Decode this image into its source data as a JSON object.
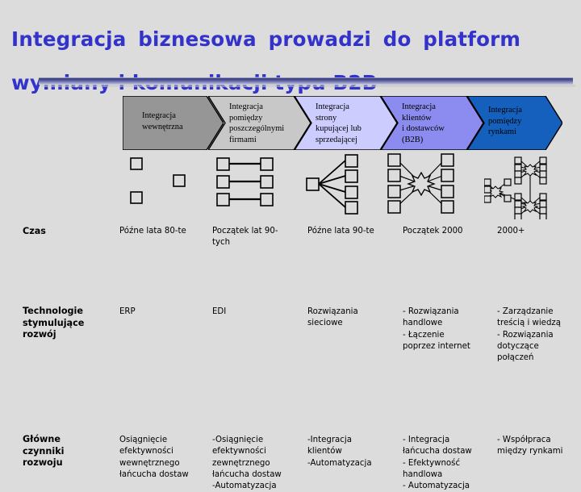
{
  "slide": {
    "background_color": "#dcdcdc",
    "title": {
      "line1": "Integracja   biznesowa   prowadzi   do   platform",
      "line2": "wymiany i komunikacji typu B2B",
      "color": "#3333cc"
    }
  },
  "stages": [
    {
      "id": "stage-1",
      "label": "Integracja\nwewnętrzna",
      "fill": "#969696",
      "stroke": "#000000",
      "notched": false
    },
    {
      "id": "stage-2",
      "label": "Integracja\npomiędzy\nposzczególnymi\nfirmami",
      "fill": "#c8c8c8",
      "stroke": "#000000",
      "notched": true
    },
    {
      "id": "stage-3",
      "label": "Integracja\nstrony\nkupującej lub\nsprzedającej",
      "fill": "#ccccff",
      "stroke": "#000000",
      "notched": true
    },
    {
      "id": "stage-4",
      "label": "Integracja\nklientów\ni dostawców\n(B2B)",
      "fill": "#8c8cf0",
      "stroke": "#000000",
      "notched": true
    },
    {
      "id": "stage-5",
      "label": "Integracja\npomiędzy\nrynkami",
      "fill": "#1560bd",
      "stroke": "#000000",
      "notched": true
    }
  ],
  "diagrams": [
    {
      "id": "diagram-isolated-nodes",
      "description": "three isolated squares, no links"
    },
    {
      "id": "diagram-paired-nodes",
      "description": "three horizontal pairs of linked squares"
    },
    {
      "id": "diagram-fan-out",
      "description": "one node fanning out to four nodes"
    },
    {
      "id": "diagram-hub-burst",
      "description": "starburst hub linking four left and four right nodes"
    },
    {
      "id": "diagram-multi-hub",
      "description": "three interlinked hub clusters"
    }
  ],
  "table": {
    "rows": [
      {
        "label": "Czas",
        "cells": [
          "Późne lata 80-te",
          "Początek lat 90-\ntych",
          "Późne lata 90-te",
          "Początek 2000",
          "2000+"
        ]
      },
      {
        "label": "Technologie\nstymulujące\nrozwój",
        "cells": [
          "ERP",
          "EDI",
          "Rozwiązania\nsieciowe",
          "- Rozwiązania\nhandlowe\n- Łączenie\npoprzez internet",
          "- Zarządzanie\ntreścią i wiedzą\n- Rozwiązania\ndotyczące\npołączeń"
        ]
      },
      {
        "label": "Główne\nczynniki\nrozwoju",
        "cells": [
          "Osiągnięcie\nefektywności\nwewnętrznego\nłańcucha dostaw",
          "-Osiągnięcie\nefektywności\nzewnętrznego\nłańcucha dostaw\n-Automatyzacja",
          "-Integracja\nklientów\n-Automatyzacja",
          "- Integracja\nłańcucha dostaw\n- Efektywność\nhandlowa\n- Automatyzacja",
          "- Współpraca\nmiędzy rynkami"
        ]
      }
    ]
  }
}
